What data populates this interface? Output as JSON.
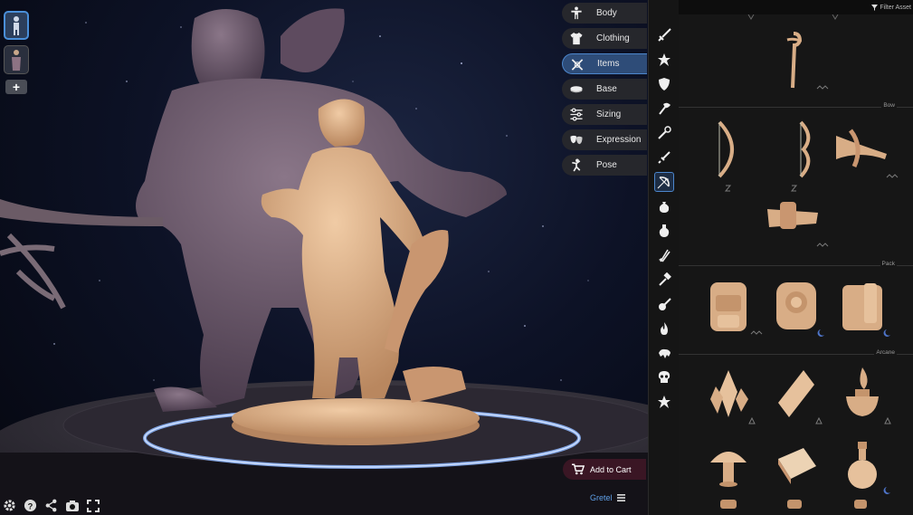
{
  "viewport": {
    "characters": [
      {
        "name": "character-1",
        "active": true
      },
      {
        "name": "character-2",
        "active": false
      }
    ],
    "add_label": "+",
    "tools": [
      "gear-icon",
      "help-icon",
      "share-icon",
      "camera-icon",
      "fullscreen-icon"
    ]
  },
  "categories": [
    {
      "label": "Body",
      "icon": "body-icon",
      "active": false
    },
    {
      "label": "Clothing",
      "icon": "shirt-icon",
      "active": false
    },
    {
      "label": "Items",
      "icon": "crossed-swords-icon",
      "active": true
    },
    {
      "label": "Base",
      "icon": "base-icon",
      "active": false
    },
    {
      "label": "Sizing",
      "icon": "sliders-icon",
      "active": false
    },
    {
      "label": "Expression",
      "icon": "masks-icon",
      "active": false
    },
    {
      "label": "Pose",
      "icon": "pose-icon",
      "active": false
    }
  ],
  "cart": {
    "label": "Add to Cart"
  },
  "user": {
    "name": "Gretel"
  },
  "filter": {
    "label": "Filter Asset"
  },
  "item_rail": [
    "sword-icon",
    "star-icon",
    "shield-icon",
    "axe-icon",
    "wand-icon",
    "dagger-icon",
    "bow-icon",
    "pouch-icon",
    "potion-icon",
    "quiver-icon",
    "hammer-icon",
    "lute-icon",
    "fire-icon",
    "animal-icon",
    "skull-icon",
    "favorite-icon"
  ],
  "sections": [
    {
      "title": "Bow"
    },
    {
      "title": "Pack"
    },
    {
      "title": "Arcane"
    }
  ],
  "colors": {
    "accent": "#4c86cc",
    "cart": "#3a1624",
    "miniature": "#d8ad86",
    "monster": "#6e5b6f",
    "ring_glow": "#8fb8ff"
  }
}
